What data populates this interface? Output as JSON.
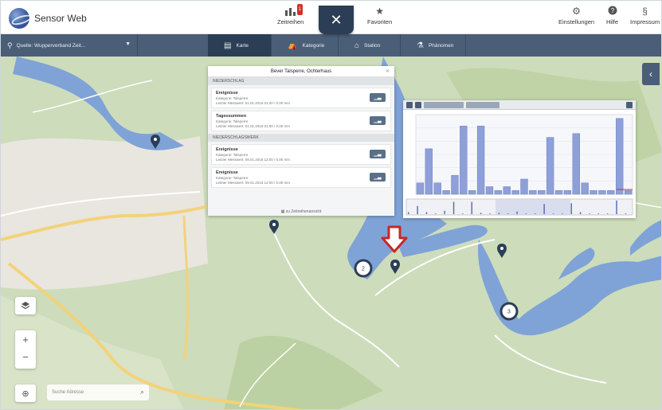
{
  "app": {
    "title": "Sensor Web"
  },
  "topnav": {
    "zeitreihen": {
      "label": "Zeitreihen",
      "badge": "1"
    },
    "favoriten": {
      "label": "Favoriten"
    },
    "einstellungen": {
      "label": "Einstellungen"
    },
    "hilfe": {
      "label": "Hilfe"
    },
    "impressum": {
      "label": "Impressum"
    },
    "close": "✕"
  },
  "subbar": {
    "source": "Quelle: Wupperverband Zeit...",
    "tabs": [
      {
        "label": "Karte",
        "icon": "map-icon",
        "active": true
      },
      {
        "label": "Kategorie",
        "icon": "category-icon",
        "active": false
      },
      {
        "label": "Station",
        "icon": "home-icon",
        "active": false
      },
      {
        "label": "Phänomen",
        "icon": "phenomenon-icon",
        "active": false
      }
    ]
  },
  "panel": {
    "title": "Bever Talsperre, Ochterhaus",
    "groups": [
      {
        "name": "Niederschlag",
        "items": [
          {
            "title": "Ereignisse",
            "sub1": "Kategorie: Talsperre",
            "sub2": "Letzter Messwert: 01.01.2015 01:00 / 0.00 mm"
          },
          {
            "title": "Tagessummen",
            "sub1": "Kategorie: Talsperre",
            "sub2": "Letzter Messwert: 01.01.2015 01:00 / 0.00 mm"
          }
        ]
      },
      {
        "name": "Niederschlagswerk",
        "items": [
          {
            "title": "Ereignisse",
            "sub1": "Kategorie: Talsperre",
            "sub2": "Letzter Messwert: 09.01.2015 12:00 / 0.00 mm"
          },
          {
            "title": "Ereignisse",
            "sub1": "Kategorie: Talsperre",
            "sub2": "Letzter Messwert: 09.01.2015 12:00 / 0.00 mm"
          }
        ]
      }
    ],
    "footer": "zu Zeitreihenansicht"
  },
  "map": {
    "search_placeholder": "Suche Adresse",
    "markers": [
      {
        "type": "pin"
      },
      {
        "type": "pin"
      },
      {
        "type": "pin"
      },
      {
        "type": "pin"
      },
      {
        "type": "cluster",
        "count": "2"
      },
      {
        "type": "cluster",
        "count": "3"
      }
    ]
  },
  "chart_data": {
    "type": "bar",
    "values": [
      3,
      12,
      3,
      1,
      5,
      18,
      1,
      18,
      2,
      1,
      2,
      1,
      4,
      1,
      1,
      15,
      1,
      1,
      16,
      3,
      1,
      1,
      1,
      20,
      1
    ],
    "color": "#8f9fd8",
    "ylim": [
      0,
      21
    ]
  },
  "colors": {
    "navbar": "#4a5e78",
    "navbar_active": "#2c3e56",
    "accent_red": "#d0312d",
    "water": "#7fa3d6",
    "pin": "#2c3e56"
  }
}
